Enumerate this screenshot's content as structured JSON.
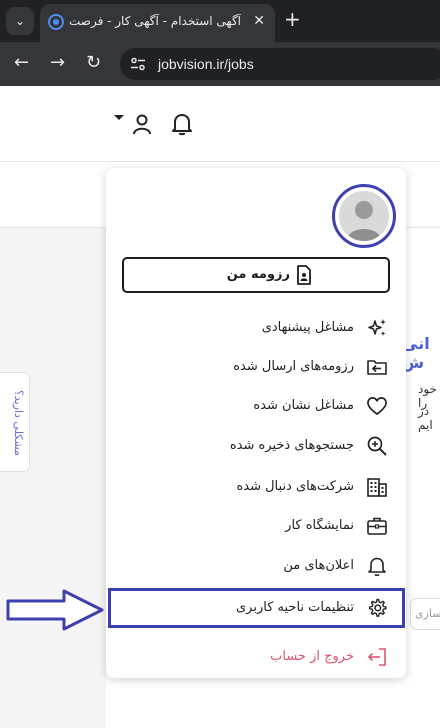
{
  "browser": {
    "tab_title": "آگهی استخدام - آگهی کار - فرصت",
    "url": "jobvision.ir/jobs",
    "close_glyph": "✕",
    "new_tab_glyph": "+",
    "tab_list_glyph": "⌄",
    "back_glyph": "←",
    "forward_glyph": "→",
    "reload_glyph": "↻"
  },
  "page": {
    "feedback_label": "مشکلی دارید؟",
    "bg_title": "انی ش",
    "bg_line_1": "خود را",
    "bg_line_2": "در ایم",
    "bg_input_placeholder": "سازی"
  },
  "user_menu": {
    "resume_button": "رزومه من",
    "items": [
      {
        "label": "مشاغل پیشنهادی",
        "icon": "sparkles-icon"
      },
      {
        "label": "رزومه‌های ارسال شده",
        "icon": "folder-arrow-icon"
      },
      {
        "label": "مشاغل نشان شده",
        "icon": "heart-icon"
      },
      {
        "label": "جستجوهای ذخیره شده",
        "icon": "search-plus-icon"
      },
      {
        "label": "شرکت‌های دنبال شده",
        "icon": "building-icon"
      },
      {
        "label": "نمایشگاه کار",
        "icon": "briefcase-icon"
      },
      {
        "label": "اعلان‌های من",
        "icon": "bell-icon"
      },
      {
        "label": "تنظیمات ناحیه کاربری",
        "icon": "gear-icon"
      },
      {
        "label": "خروج از حساب",
        "icon": "logout-icon"
      }
    ]
  },
  "colors": {
    "highlight": "#3e3fb0",
    "logout": "#e0546e",
    "arrow": "#3e3fb0"
  }
}
